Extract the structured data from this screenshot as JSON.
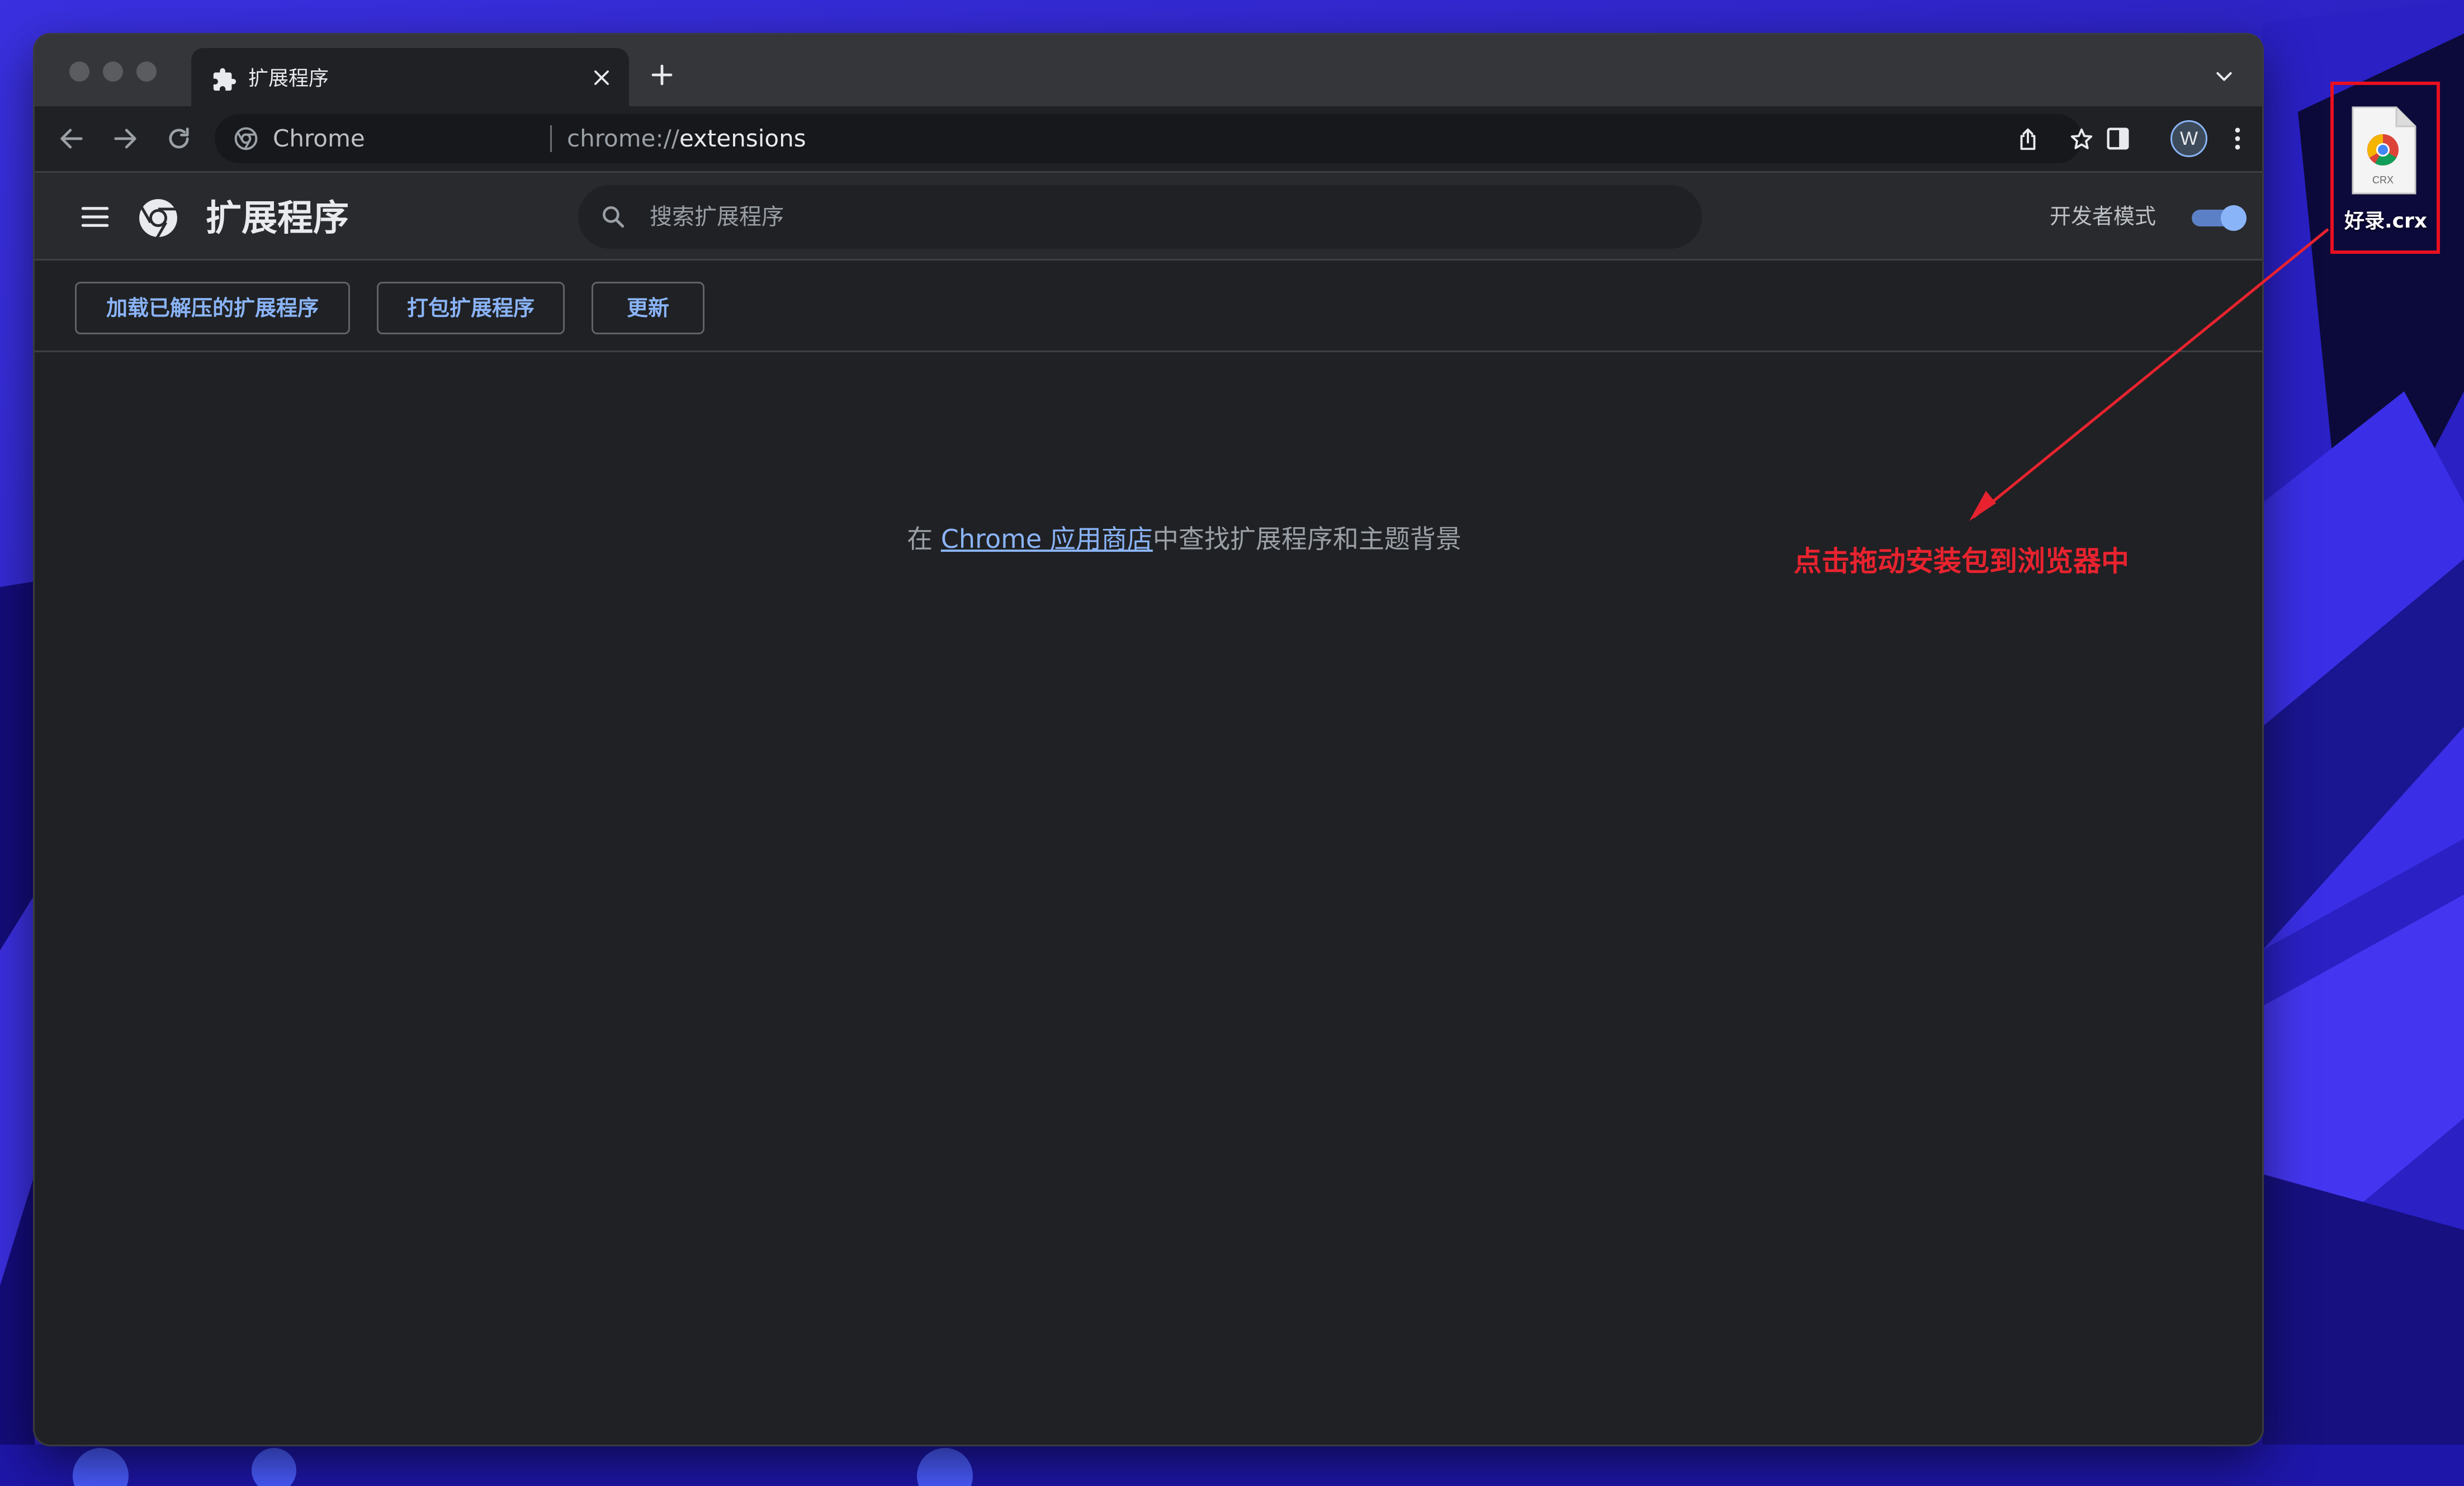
{
  "colors": {
    "accent": "#8ab4f8",
    "annotation": "#e8232f",
    "page_bg": "#202124"
  },
  "browser": {
    "tab": {
      "title": "扩展程序",
      "icon": "puzzle-piece-icon"
    },
    "omnibox": {
      "site_label": "Chrome",
      "url_scheme": "chrome://",
      "url_path": "extensions"
    },
    "profile_initial": "W"
  },
  "extensions_page": {
    "title": "扩展程序",
    "search": {
      "placeholder": "搜索扩展程序"
    },
    "developer_mode": {
      "label": "开发者模式",
      "enabled": true
    },
    "buttons": {
      "load_unpacked": "加载已解压的扩展程序",
      "pack": "打包扩展程序",
      "update": "更新"
    },
    "empty_state": {
      "prefix": "在 ",
      "link": "Chrome 应用商店",
      "suffix": "中查找扩展程序和主题背景"
    }
  },
  "desktop": {
    "file": {
      "name": "好录.crx",
      "type_label": "CRX"
    }
  },
  "annotation": {
    "text": "点击拖动安装包到浏览器中"
  }
}
